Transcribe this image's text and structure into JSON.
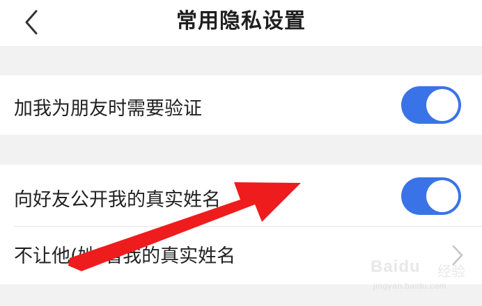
{
  "header": {
    "title": "常用隐私设置",
    "back_icon": "chevron-left-icon"
  },
  "settings": {
    "friend_verification": {
      "label": "加我为朋友时需要验证",
      "enabled": true
    },
    "public_real_name": {
      "label": "向好友公开我的真实姓名",
      "enabled": true
    },
    "hide_real_name_from": {
      "label": "不让他(她)看我的真实姓名",
      "icon": "chevron-right-icon"
    }
  },
  "colors": {
    "toggle_on": "#3a73e8",
    "annotation_arrow": "#ee1c1c",
    "background": "#f2f2f2",
    "row_background": "#ffffff"
  },
  "watermark": {
    "brand": "Baidu",
    "sub": "经验",
    "url": "jingyan.baidu.com"
  }
}
